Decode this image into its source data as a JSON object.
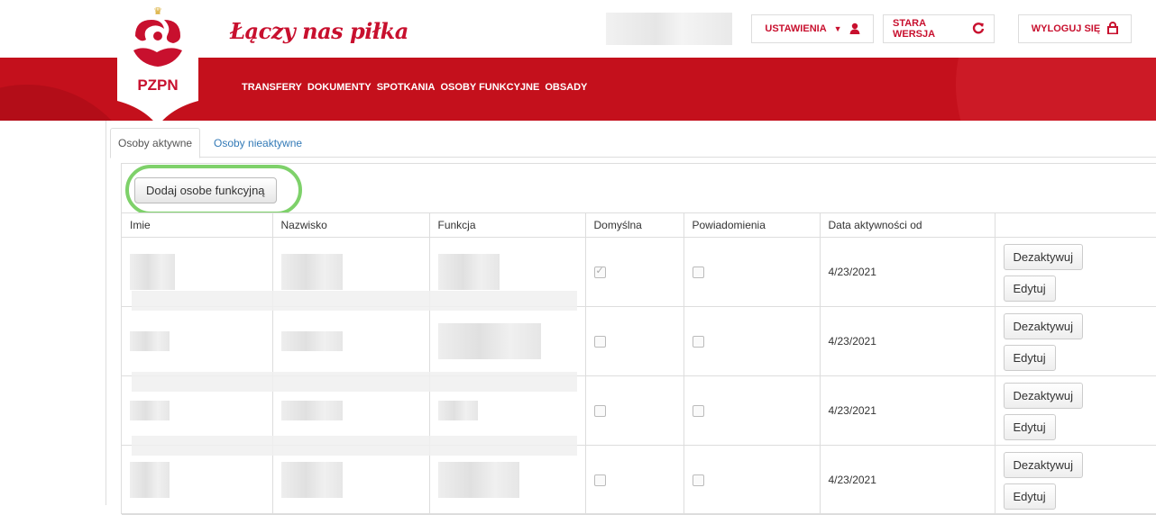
{
  "header": {
    "tagline": "Łączy nas piłka",
    "logo_text": "PZPN",
    "buttons": [
      {
        "label": "USTAWIENIA",
        "icon": "user-icon"
      },
      {
        "label": "STARA WERSJA",
        "icon": "refresh-icon"
      },
      {
        "label": "WYLOGUJ SIĘ",
        "icon": "lock-icon"
      }
    ]
  },
  "nav": [
    "TRANSFERY",
    "DOKUMENTY",
    "SPOTKANIA",
    "OSOBY FUNKCYJNE",
    "OBSADY"
  ],
  "tabs": {
    "active": "Osoby aktywne",
    "inactive": "Osoby nieaktywne"
  },
  "panel": {
    "add_button": "Dodaj osobe funkcyjną"
  },
  "table": {
    "headers": [
      "Imie",
      "Nazwisko",
      "Funkcja",
      "Domyślna",
      "Powiadomienia",
      "Data aktywności od",
      ""
    ],
    "rows": [
      {
        "date": "4/23/2021",
        "default": true,
        "notify": false,
        "deactivate": "Dezaktywuj",
        "edit": "Edytuj"
      },
      {
        "date": "4/23/2021",
        "default": false,
        "notify": false,
        "deactivate": "Dezaktywuj",
        "edit": "Edytuj"
      },
      {
        "date": "4/23/2021",
        "default": false,
        "notify": false,
        "deactivate": "Dezaktywuj",
        "edit": "Edytuj"
      },
      {
        "date": "4/23/2021",
        "default": false,
        "notify": false,
        "deactivate": "Dezaktywuj",
        "edit": "Edytuj"
      }
    ]
  },
  "colors": {
    "brand_red": "#c4101c",
    "highlight_green": "#7ed16a",
    "link_blue": "#337ab7"
  }
}
